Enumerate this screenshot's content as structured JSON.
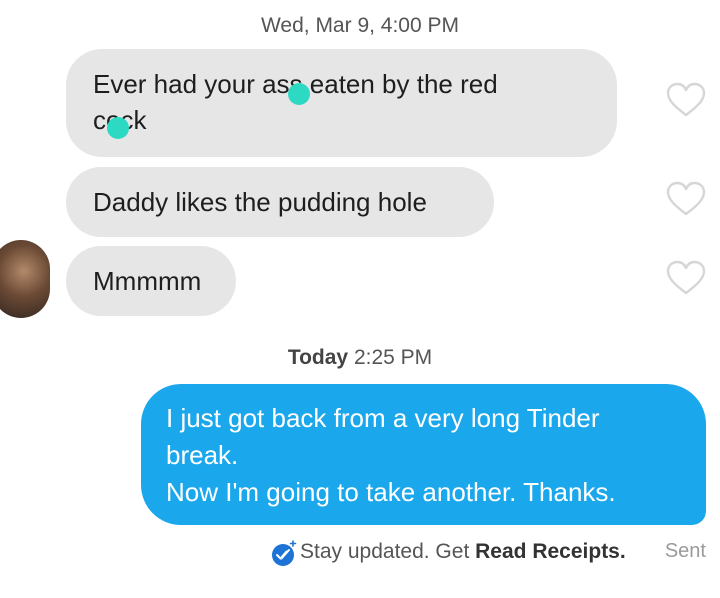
{
  "conversation": {
    "header_timestamp": {
      "day": "Wed, Mar 9,",
      "time": "4:00 PM"
    },
    "incoming_messages": [
      {
        "line1": "Ever had your ass eaten by the red",
        "line2": "cock"
      },
      {
        "text": "Daddy likes the pudding hole"
      },
      {
        "text": "Mmmmm"
      }
    ],
    "today_timestamp": {
      "day": "Today",
      "time": "2:25 PM"
    },
    "outgoing_message": {
      "line1": "I just got back from a very long Tinder",
      "line2": "break.",
      "line3": "Now I'm going to take another. Thanks."
    },
    "receipts": {
      "prefix": "Stay updated. Get",
      "link": "Read Receipts.",
      "status": "Sent"
    }
  },
  "colors": {
    "incoming_bubble": "#e6e6e6",
    "outgoing_bubble": "#1aa7ec",
    "censor_dot": "#2ed9c3",
    "receipt_icon": "#1e73d6"
  },
  "icons": {
    "like": "heart-outline-icon",
    "receipt": "double-check-badge-icon"
  }
}
